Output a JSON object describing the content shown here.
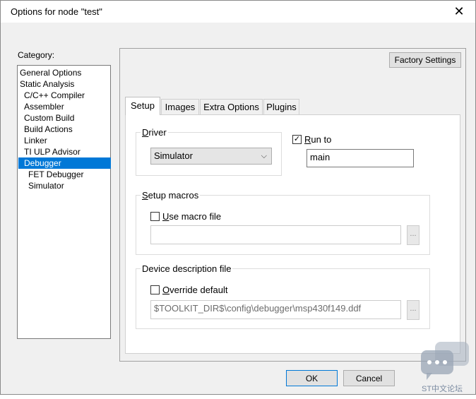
{
  "window": {
    "title": "Options for node \"test\"",
    "close_glyph": "✕"
  },
  "category": {
    "label": "Category:",
    "items": [
      {
        "label": "General Options",
        "indent": 0,
        "selected": false
      },
      {
        "label": "Static Analysis",
        "indent": 0,
        "selected": false
      },
      {
        "label": "C/C++ Compiler",
        "indent": 1,
        "selected": false
      },
      {
        "label": "Assembler",
        "indent": 1,
        "selected": false
      },
      {
        "label": "Custom Build",
        "indent": 1,
        "selected": false
      },
      {
        "label": "Build Actions",
        "indent": 1,
        "selected": false
      },
      {
        "label": "Linker",
        "indent": 1,
        "selected": false
      },
      {
        "label": "TI ULP Advisor",
        "indent": 1,
        "selected": false
      },
      {
        "label": "Debugger",
        "indent": 1,
        "selected": true
      },
      {
        "label": "FET Debugger",
        "indent": 2,
        "selected": false
      },
      {
        "label": "Simulator",
        "indent": 2,
        "selected": false
      }
    ]
  },
  "factory_settings_label": "Factory Settings",
  "tabs": [
    {
      "label": "Setup",
      "active": true
    },
    {
      "label": "Images",
      "active": false
    },
    {
      "label": "Extra Options",
      "active": false
    },
    {
      "label": "Plugins",
      "active": false
    }
  ],
  "driver": {
    "group_title_u": "D",
    "group_title_rest": "river",
    "selected": "Simulator",
    "chevron": "⌵"
  },
  "run_to": {
    "checked_mark": "✓",
    "label_u": "R",
    "label_rest": "un to",
    "value": "main"
  },
  "setup_macros": {
    "group_title_u": "S",
    "group_title_rest": "etup macros",
    "checkbox_label_u": "U",
    "checkbox_label_rest": "se macro file",
    "path": "",
    "browse_label": "..."
  },
  "device_description": {
    "group_title": "Device description file",
    "checkbox_label_u": "O",
    "checkbox_label_rest": "verride default",
    "path": "$TOOLKIT_DIR$\\config\\debugger\\msp430f149.ddf",
    "browse_label": "..."
  },
  "buttons": {
    "ok": "OK",
    "cancel": "Cancel"
  },
  "watermark": {
    "text": "ST中文论坛"
  }
}
